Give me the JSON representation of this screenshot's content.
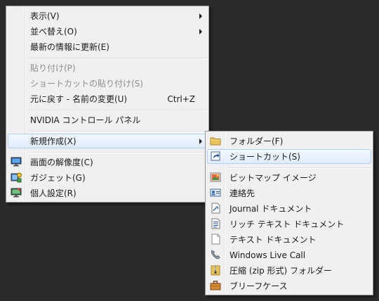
{
  "main_menu": {
    "view": "表示(V)",
    "sort": "並べ替え(O)",
    "refresh": "最新の情報に更新(E)",
    "paste": "貼り付け(P)",
    "paste_shortcut": "ショートカットの貼り付け(S)",
    "undo": "元に戻す - 名前の変更(U)",
    "undo_shortcut": "Ctrl+Z",
    "nvidia": "NVIDIA コントロール パネル",
    "new": "新規作成(X)",
    "resolution": "画面の解像度(C)",
    "gadgets": "ガジェット(G)",
    "personalize": "個人設定(R)"
  },
  "new_submenu": {
    "folder": "フォルダー(F)",
    "shortcut": "ショートカット(S)",
    "bitmap": "ビットマップ イメージ",
    "contact": "連絡先",
    "journal": "Journal ドキュメント",
    "rtf": "リッチ テキスト ドキュメント",
    "text": "テキスト ドキュメント",
    "live_call": "Windows Live Call",
    "zip": "圧縮 (zip 形式) フォルダー",
    "briefcase": "ブリーフケース"
  },
  "icons": {
    "resolution": "monitor-icon",
    "gadgets": "gadgets-icon",
    "personalize": "personalize-icon",
    "folder": "folder-icon",
    "shortcut": "shortcut-icon",
    "bitmap": "bitmap-icon",
    "contact": "contact-card-icon",
    "journal": "journal-document-icon",
    "rtf": "rich-text-document-icon",
    "text": "text-document-icon",
    "live_call": "phone-icon",
    "zip": "zip-folder-icon",
    "briefcase": "briefcase-icon"
  },
  "colors": {
    "background": "#2b2b2b",
    "menu_background": "#f0f0f0",
    "highlight_border": "#aecff7",
    "disabled_text": "#8d8d8d"
  }
}
